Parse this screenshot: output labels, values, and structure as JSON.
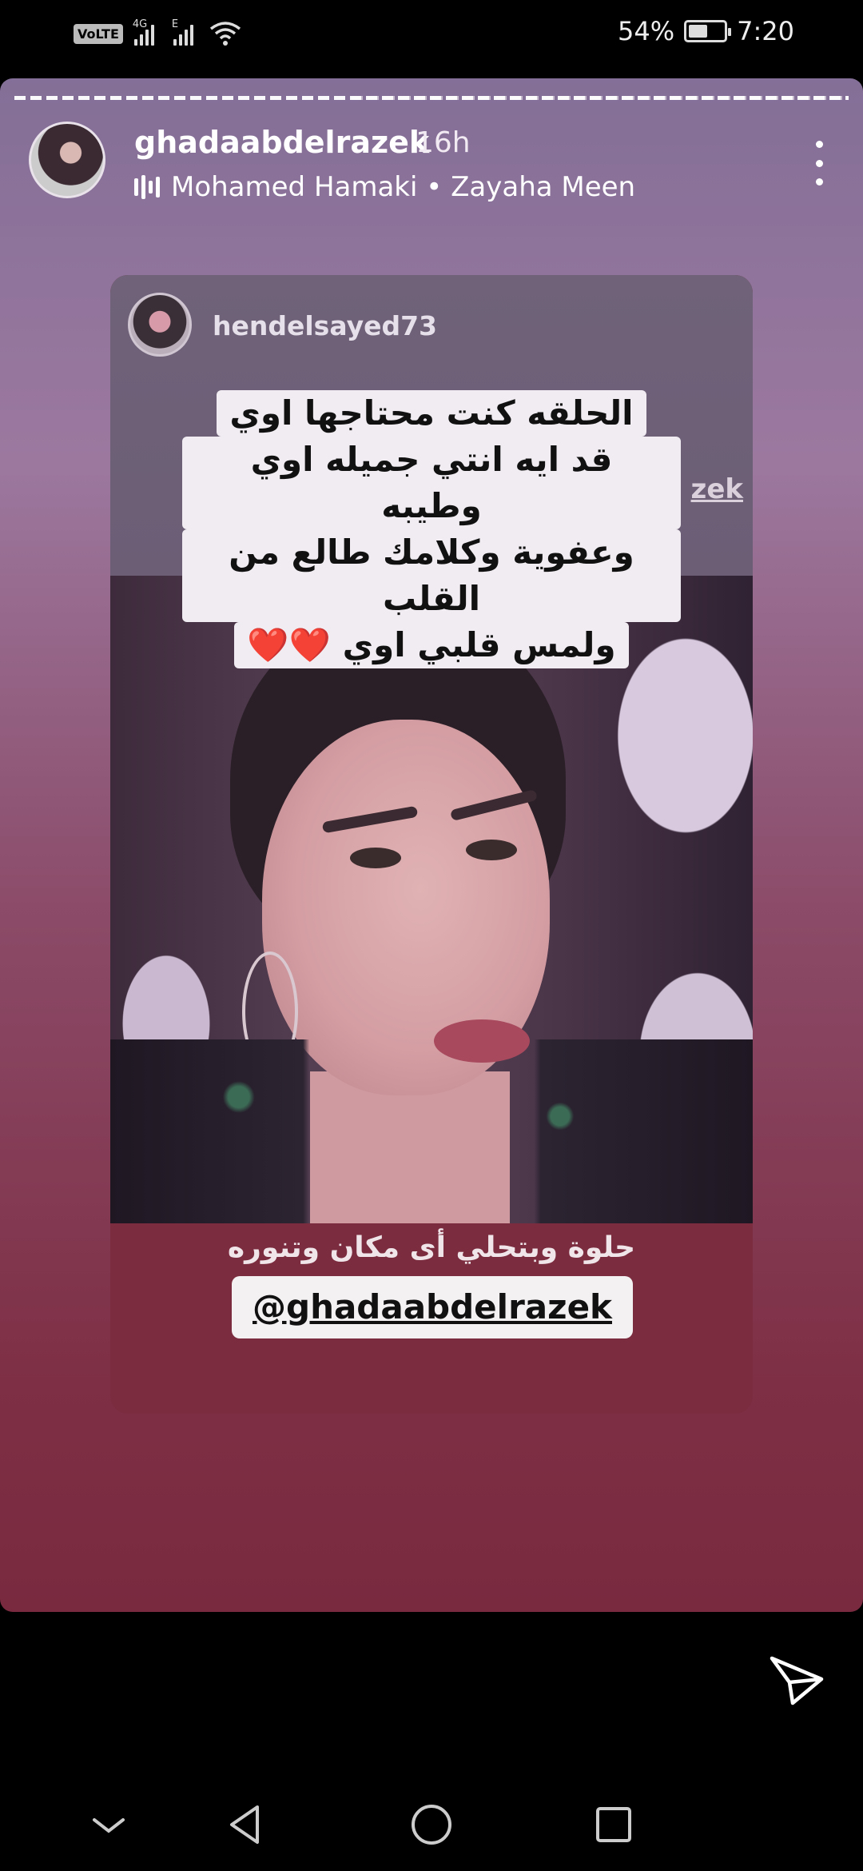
{
  "status_bar": {
    "volte": "VoLTE",
    "net1": "4G",
    "net2": "E",
    "battery": "54%",
    "battery_level": 0.54,
    "time": "7:20"
  },
  "story": {
    "username": "ghadaabdelrazek",
    "time_ago": "16h",
    "music": "Mohamed Hamaki • Zayaha Meen",
    "icons": {
      "music": "music-bars-icon",
      "more": "more-options-icon"
    }
  },
  "repost": {
    "username": "hendelsayed73",
    "overlay_partial": "zek",
    "quote_lines": [
      "الحلقه كنت محتاجها اوي",
      "قد ايه انتي جميله اوي وطيبه",
      "وعفوية وكلامك طالع من القلب",
      "ولمس قلبي اوي ❤️❤️"
    ],
    "caption": "حلوة وبتحلي أى مكان وتنوره",
    "mention": "@ghadaabdelrazek"
  },
  "controls": {
    "send": "send-icon",
    "back": "nav-back-icon",
    "home": "nav-home-icon",
    "recents": "nav-recents-icon",
    "collapse": "chevron-down-icon"
  }
}
